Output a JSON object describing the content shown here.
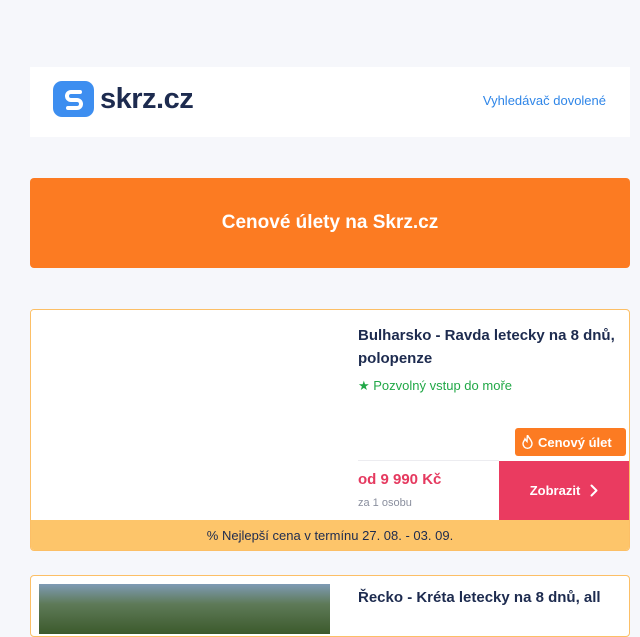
{
  "header": {
    "logo_text": "skrz.cz",
    "link_label": "Vyhledávač dovolené"
  },
  "banner": {
    "title": "Cenové úlety na Skrz.cz"
  },
  "offers": [
    {
      "title": "Bulharsko - Ravda letecky na 8 dnů, polopenze",
      "feature": "★ Pozvolný vstup do moře",
      "badge": "Cenový úlet",
      "price": "od 9 990 Kč",
      "price_note": "za 1 osobu",
      "button_label": "Zobrazit",
      "deal_text": "% Nejlepší cena v termínu 27. 08. - 03. 09."
    },
    {
      "title": "Řecko - Kréta letecky na 8 dnů, all"
    }
  ],
  "colors": {
    "accent_orange": "#fc7b22",
    "brand_blue": "#3d8ef0",
    "button_red": "#ea3b60",
    "deal_yellow": "#fdc56a"
  }
}
